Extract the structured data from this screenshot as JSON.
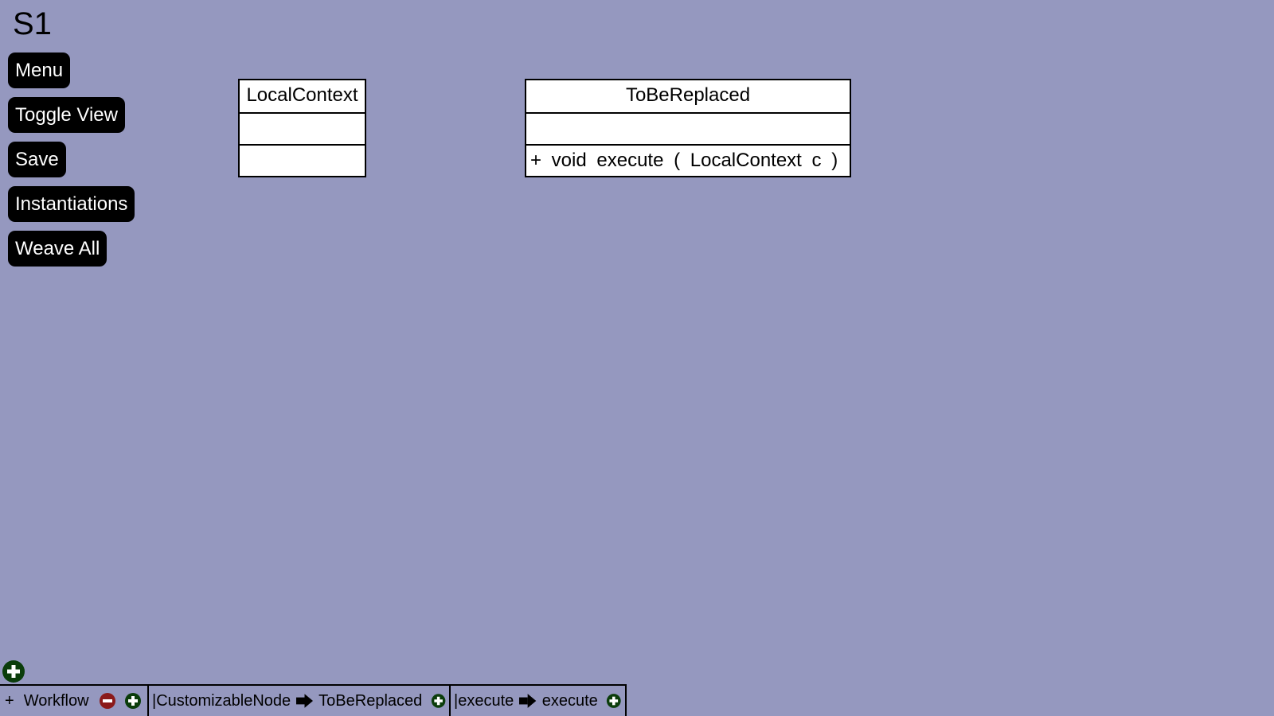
{
  "title": "S1",
  "menu_buttons": [
    {
      "label": "Menu"
    },
    {
      "label": "Toggle View"
    },
    {
      "label": "Save"
    },
    {
      "label": "Instantiations"
    },
    {
      "label": "Weave All"
    }
  ],
  "classes": [
    {
      "name": "LocalContext",
      "attributes": "",
      "operations": ""
    },
    {
      "name": "ToBeReplaced",
      "attributes": "",
      "operations": "+ void execute ( LocalContext c )"
    }
  ],
  "bottom_bar": {
    "workflow_prefix": "+",
    "workflow_label": "Workflow",
    "mappings": [
      {
        "source": "|CustomizableNode",
        "target": "ToBeReplaced"
      },
      {
        "source": "|execute",
        "target": "execute"
      }
    ]
  },
  "colors": {
    "background": "#9598bf",
    "button": "#000000",
    "remove_icon": "#8b1a1a",
    "add_icon": "#0b3d0b"
  }
}
